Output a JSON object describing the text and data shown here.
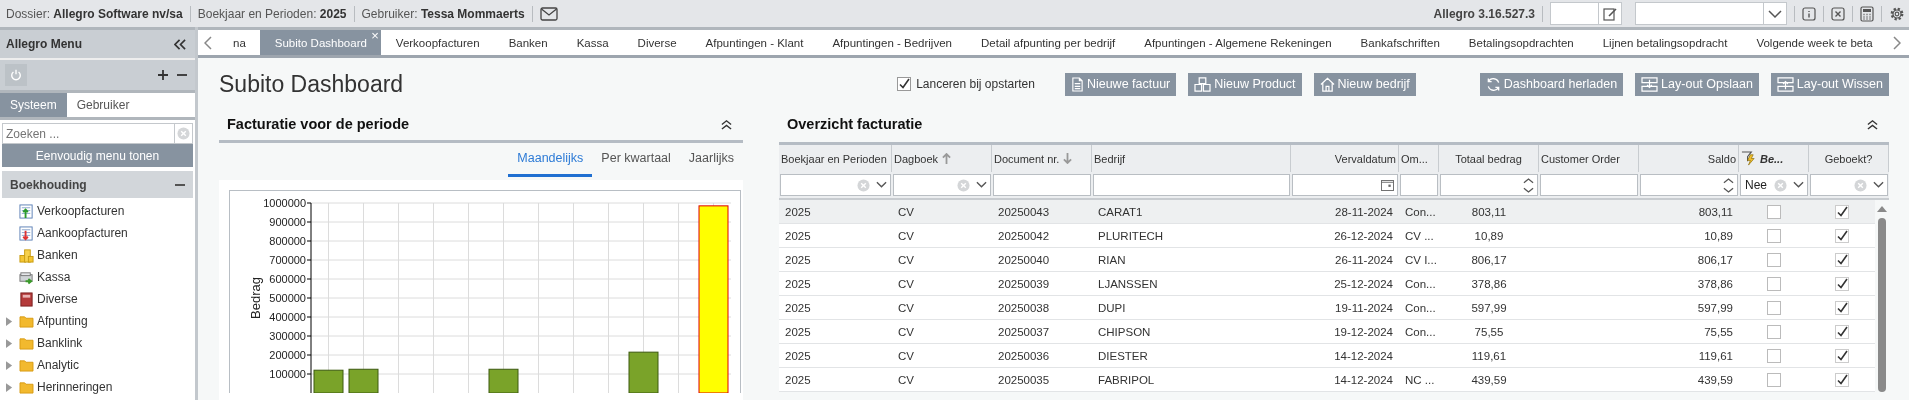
{
  "top_bar": {
    "info": [
      "Dossier: **Allegro Software nv/sa**",
      "Boekjaar en Perioden: **2025**",
      "Gebruiker: **Tessa Mommaerts**"
    ],
    "version": "Allegro 3.16.527.3"
  },
  "sidebar": {
    "title": "Allegro Menu",
    "tabs": [
      {
        "label": "Systeem",
        "selected": true
      },
      {
        "label": "Gebruiker",
        "selected": false
      }
    ],
    "search": {
      "placeholder": "Zoeken ..."
    },
    "simple_menu_button": "Eenvoudig menu tonen",
    "section": "Boekhouding",
    "items": [
      {
        "label": "Verkoopfacturen",
        "kind": "sales"
      },
      {
        "label": "Aankoopfacturen",
        "kind": "purchase"
      },
      {
        "label": "Banken",
        "kind": "bank"
      },
      {
        "label": "Kassa",
        "kind": "cash"
      },
      {
        "label": "Diverse",
        "kind": "book"
      },
      {
        "label": "Afpunting",
        "kind": "folder",
        "expanded": false
      },
      {
        "label": "Banklink",
        "kind": "folder",
        "expanded": false
      },
      {
        "label": "Analytic",
        "kind": "folder",
        "expanded": false
      },
      {
        "label": "Herinneringen",
        "kind": "folder",
        "expanded": false
      }
    ]
  },
  "tabs": [
    {
      "label": "na",
      "selected": false
    },
    {
      "label": "Subito Dashboard",
      "selected": true,
      "close": "×"
    },
    {
      "label": "Verkoopfacturen",
      "selected": false
    },
    {
      "label": "Banken",
      "selected": false
    },
    {
      "label": "Kassa",
      "selected": false
    },
    {
      "label": "Diverse",
      "selected": false
    },
    {
      "label": "Afpuntingen - Klant",
      "selected": false
    },
    {
      "label": "Afpuntingen - Bedrijven",
      "selected": false
    },
    {
      "label": "Detail afpunting per bedrijf",
      "selected": false
    },
    {
      "label": "Afpuntingen - Algemene Rekeningen",
      "selected": false
    },
    {
      "label": "Bankafschriften",
      "selected": false
    },
    {
      "label": "Betalingsopdrachten",
      "selected": false
    },
    {
      "label": "Lijnen betalingsopdracht",
      "selected": false
    },
    {
      "label": "Volgende week te beta",
      "selected": false
    }
  ],
  "page_title": "Subito Dashboard",
  "launch_on_startup": {
    "label": "Lanceren bij opstarten",
    "checked": true
  },
  "actions": [
    {
      "label": "Nieuwe factuur",
      "kind": "invoice"
    },
    {
      "label": "Nieuw Product",
      "kind": "product"
    },
    {
      "label": "Nieuw bedrijf",
      "kind": "company"
    },
    {
      "label": "Dashboard herladen",
      "kind": "reload"
    },
    {
      "label": "Lay-out Opslaan",
      "kind": "save"
    },
    {
      "label": "Lay-out Wissen",
      "kind": "clear"
    }
  ],
  "invoicing_panel": {
    "title": "Facturatie voor de periode",
    "periods": [
      {
        "label": "Maandelijks",
        "selected": true
      },
      {
        "label": "Per kwartaal",
        "selected": false
      },
      {
        "label": "Jaarlijks",
        "selected": false
      }
    ],
    "chart_data": {
      "type": "bar",
      "grid": true,
      "ylabel": "Bedrag",
      "ylim": [
        0,
        1000000
      ],
      "yticks": [
        100000,
        200000,
        300000,
        400000,
        500000,
        600000,
        700000,
        800000,
        900000,
        1000000
      ],
      "stacked": true,
      "series": [
        {
          "color": "#7aa329",
          "values": [
            120000,
            125000,
            null,
            null,
            null,
            125000,
            null,
            null,
            null,
            215000,
            null,
            null
          ]
        },
        {
          "color": "#ffff00",
          "values": [
            null,
            null,
            null,
            null,
            null,
            null,
            null,
            null,
            null,
            null,
            null,
            985000
          ]
        }
      ]
    }
  },
  "overview_panel": {
    "title": "Overzicht facturatie",
    "columns": [
      {
        "label": "Boekjaar en Perioden",
        "kind": "select"
      },
      {
        "label": "Dagboek",
        "sorted": true,
        "descending": false,
        "kind": "select"
      },
      {
        "label": "Document nr.",
        "sorted": true,
        "descending": true,
        "kind": "text"
      },
      {
        "label": "Bedrijf",
        "kind": "text"
      },
      {
        "label": "Vervaldatum",
        "kind": "date"
      },
      {
        "label": "Om...",
        "kind": "text"
      },
      {
        "label": "Totaal bedrag",
        "kind": "number"
      },
      {
        "label": "Customer Order",
        "kind": "text"
      },
      {
        "label": "Saldo",
        "kind": "number"
      },
      {
        "label": "Be...",
        "kind": "select",
        "filter_value": "Nee",
        "filter_icon": true
      },
      {
        "label": "Geboekt?",
        "kind": "select"
      }
    ],
    "rows": [
      {
        "selected": true,
        "cells": [
          "2025",
          "CV",
          "20250043",
          "CARAT1",
          "28-11-2024",
          "Con...",
          "803,11",
          null,
          "803,11"
        ],
        "be": false,
        "geboekt": true
      },
      {
        "selected": false,
        "cells": [
          "2025",
          "CV",
          "20250042",
          "PLURITECH",
          "26-12-2024",
          "CV ...",
          "10,89",
          null,
          "10,89"
        ],
        "be": false,
        "geboekt": true
      },
      {
        "selected": false,
        "cells": [
          "2025",
          "CV",
          "20250040",
          "RIAN",
          "26-11-2024",
          "CV I...",
          "806,17",
          null,
          "806,17"
        ],
        "be": false,
        "geboekt": true
      },
      {
        "selected": false,
        "cells": [
          "2025",
          "CV",
          "20250039",
          "LJANSSEN",
          "25-12-2024",
          "Con...",
          "378,86",
          null,
          "378,86"
        ],
        "be": false,
        "geboekt": true
      },
      {
        "selected": false,
        "cells": [
          "2025",
          "CV",
          "20250038",
          "DUPI",
          "19-11-2024",
          "Con...",
          "597,99",
          null,
          "597,99"
        ],
        "be": false,
        "geboekt": true
      },
      {
        "selected": false,
        "cells": [
          "2025",
          "CV",
          "20250037",
          "CHIPSON",
          "19-12-2024",
          "Con...",
          "75,55",
          null,
          "75,55"
        ],
        "be": false,
        "geboekt": true
      },
      {
        "selected": false,
        "cells": [
          "2025",
          "CV",
          "20250036",
          "DIESTER",
          "14-12-2024",
          null,
          "119,61",
          null,
          "119,61"
        ],
        "be": false,
        "geboekt": true
      },
      {
        "selected": false,
        "cells": [
          "2025",
          "CV",
          "20250035",
          "FABRIPOL",
          "14-12-2024",
          "NC ...",
          "439,59",
          null,
          "439,59"
        ],
        "be": false,
        "geboekt": true
      }
    ]
  }
}
